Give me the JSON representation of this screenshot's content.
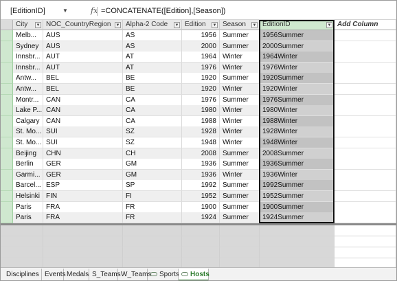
{
  "formula_bar": {
    "name_box": "[EditionID]",
    "fx_label": "fx",
    "formula": "=CONCATENATE([Edition],[Season])"
  },
  "columns": [
    {
      "label": "City"
    },
    {
      "label": "NOC_CountryRegion"
    },
    {
      "label": "Alpha-2 Code"
    },
    {
      "label": "Edition"
    },
    {
      "label": "Season"
    },
    {
      "label": "EditionID"
    },
    {
      "label": "Add Column"
    }
  ],
  "rows": [
    [
      "Melb...",
      "AUS",
      "AS",
      "1956",
      "Summer",
      "1956Summer"
    ],
    [
      "Sydney",
      "AUS",
      "AS",
      "2000",
      "Summer",
      "2000Summer"
    ],
    [
      "Innsbr...",
      "AUT",
      "AT",
      "1964",
      "Winter",
      "1964Winter"
    ],
    [
      "Innsbr...",
      "AUT",
      "AT",
      "1976",
      "Winter",
      "1976Winter"
    ],
    [
      "Antw...",
      "BEL",
      "BE",
      "1920",
      "Summer",
      "1920Summer"
    ],
    [
      "Antw...",
      "BEL",
      "BE",
      "1920",
      "Winter",
      "1920Winter"
    ],
    [
      "Montr...",
      "CAN",
      "CA",
      "1976",
      "Summer",
      "1976Summer"
    ],
    [
      "Lake P...",
      "CAN",
      "CA",
      "1980",
      "Winter",
      "1980Winter"
    ],
    [
      "Calgary",
      "CAN",
      "CA",
      "1988",
      "Winter",
      "1988Winter"
    ],
    [
      "St. Mo...",
      "SUI",
      "SZ",
      "1928",
      "Winter",
      "1928Winter"
    ],
    [
      "St. Mo...",
      "SUI",
      "SZ",
      "1948",
      "Winter",
      "1948Winter"
    ],
    [
      "Beijing",
      "CHN",
      "CH",
      "2008",
      "Summer",
      "2008Summer"
    ],
    [
      "Berlin",
      "GER",
      "GM",
      "1936",
      "Summer",
      "1936Summer"
    ],
    [
      "Garmi...",
      "GER",
      "GM",
      "1936",
      "Winter",
      "1936Winter"
    ],
    [
      "Barcel...",
      "ESP",
      "SP",
      "1992",
      "Summer",
      "1992Summer"
    ],
    [
      "Helsinki",
      "FIN",
      "FI",
      "1952",
      "Summer",
      "1952Summer"
    ],
    [
      "Paris",
      "FRA",
      "FR",
      "1900",
      "Summer",
      "1900Summer"
    ],
    [
      "Paris",
      "FRA",
      "FR",
      "1924",
      "Summer",
      "1924Summer"
    ]
  ],
  "tabs": [
    {
      "label": "Disciplines",
      "icon": "none"
    },
    {
      "label": "Events",
      "icon": "none"
    },
    {
      "label": "Medals",
      "icon": "none"
    },
    {
      "label": "S_Teams",
      "icon": "none"
    },
    {
      "label": "W_Teams",
      "icon": "none"
    },
    {
      "label": "Sports",
      "icon": "linked-table-icon"
    },
    {
      "label": "Hosts",
      "icon": "linked-table-icon",
      "active": true
    }
  ],
  "colors": {
    "selected_header": "#cfe8cf",
    "active_tab": "#2b7a2b",
    "calc_column": "#d0d0d0"
  }
}
